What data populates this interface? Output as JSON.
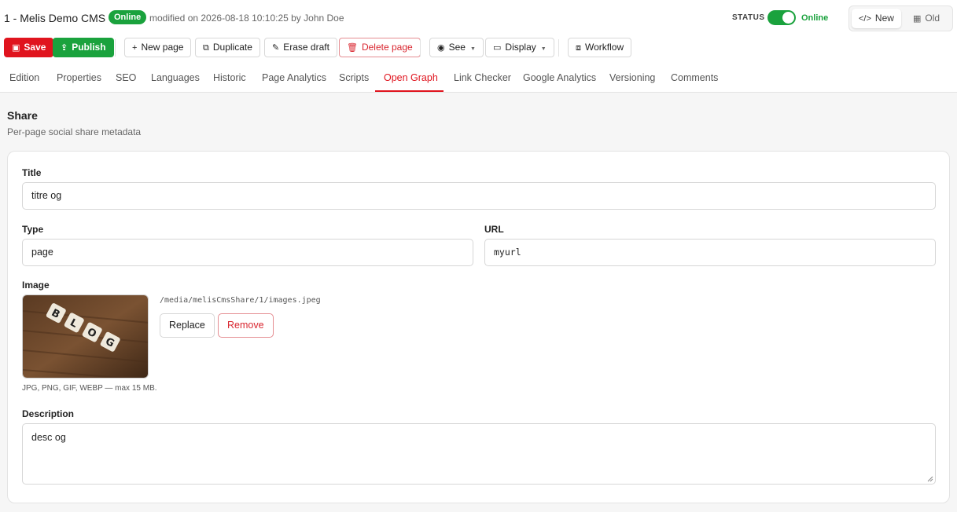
{
  "header": {
    "title": "1 - Melis Demo CMS",
    "badge": "Online",
    "modified": "modified on 2026-08-18 10:10:25 by John Doe",
    "status_label": "STATUS",
    "status_value": "Online",
    "status_on": true,
    "view_new": "New",
    "view_old": "Old"
  },
  "toolbar": {
    "save": "Save",
    "publish": "Publish",
    "new_page": "New page",
    "duplicate": "Duplicate",
    "erase_draft": "Erase draft",
    "delete_page": "Delete page",
    "see": "See",
    "display": "Display",
    "workflow": "Workflow"
  },
  "tabs": [
    {
      "label": "Edition"
    },
    {
      "label": "Properties"
    },
    {
      "label": "SEO"
    },
    {
      "label": "Languages"
    },
    {
      "label": "Historic"
    },
    {
      "label": "Page Analytics"
    },
    {
      "label": "Scripts"
    },
    {
      "label": "Open Graph",
      "active": true
    },
    {
      "label": "Link Checker"
    },
    {
      "label": "Google Analytics"
    },
    {
      "label": "Versioning"
    },
    {
      "label": "Comments"
    }
  ],
  "section": {
    "title": "Share",
    "subtitle": "Per-page social share metadata"
  },
  "form": {
    "title_label": "Title",
    "title_value": "titre og",
    "type_label": "Type",
    "type_value": "page",
    "url_label": "URL",
    "url_value": "myurl",
    "image_label": "Image",
    "image_path": "/media/melisCmsShare/1/images.jpeg",
    "replace": "Replace",
    "remove": "Remove",
    "image_hint": "JPG, PNG, GIF, WEBP — max 15 MB.",
    "description_label": "Description",
    "description_value": "desc og"
  },
  "colors": {
    "accent_red": "#e0141e",
    "success_green": "#1aa23d"
  }
}
